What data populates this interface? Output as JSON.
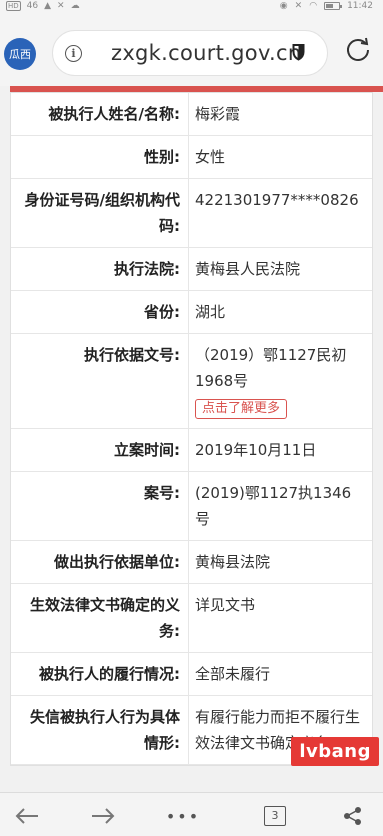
{
  "status_bar": {
    "left_badge": "HD",
    "left_signal": "46",
    "time": "11:42"
  },
  "browser": {
    "site_badge": "瓜西",
    "url": "zxgk.court.gov.cn"
  },
  "records": [
    {
      "label": "被执行人姓名/名称:",
      "value": "梅彩霞"
    },
    {
      "label": "性别:",
      "value": "女性"
    },
    {
      "label": "身份证号码/组织机构代码:",
      "value": "4221301977****0826"
    },
    {
      "label": "执行法院:",
      "value": "黄梅县人民法院"
    },
    {
      "label": "省份:",
      "value": "湖北"
    },
    {
      "label": "执行依据文号:",
      "value": "（2019）鄂1127民初1968号",
      "link": "点击了解更多"
    },
    {
      "label": "立案时间:",
      "value": "2019年10月11日"
    },
    {
      "label": "案号:",
      "value": "(2019)鄂1127执1346号"
    },
    {
      "label": "做出执行依据单位:",
      "value": "黄梅县法院"
    },
    {
      "label": "生效法律文书确定的义务:",
      "value": "详见文书"
    },
    {
      "label": "被执行人的履行情况:",
      "value": "全部未履行"
    },
    {
      "label": "失信被执行人行为具体情形:",
      "value": "有履行能力而拒不履行生效法律文书确定义务"
    }
  ],
  "watermark": "lvbang",
  "bottom_bar": {
    "tab_count": "3"
  },
  "colors": {
    "accent_red": "#d9534f",
    "badge_blue": "#2a63b8"
  },
  "battery_level": 0.6
}
